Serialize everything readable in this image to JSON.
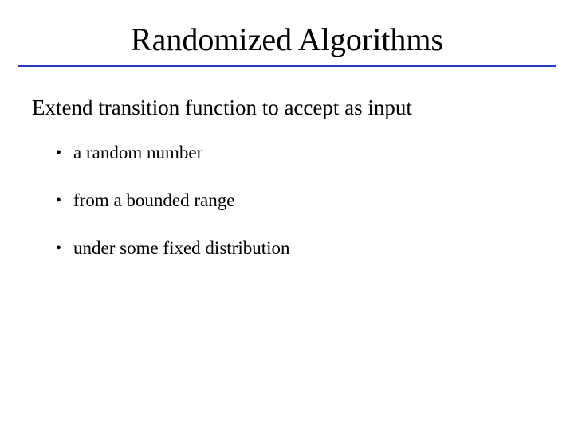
{
  "title": "Randomized Algorithms",
  "lead": "Extend transition function to accept as input",
  "bullets": [
    "a random number",
    "from a bounded range",
    "under some fixed distribution"
  ]
}
